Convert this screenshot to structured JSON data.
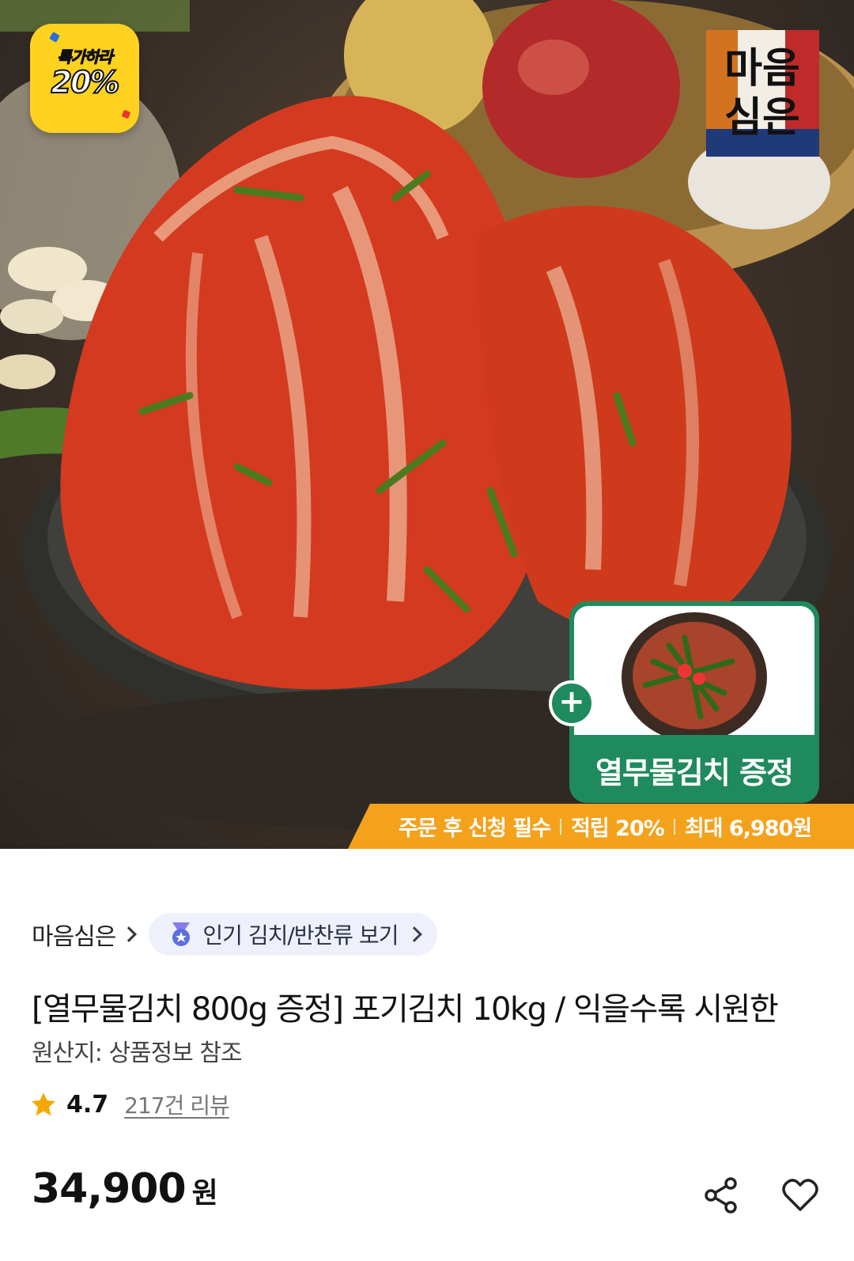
{
  "hero": {
    "deal_badge": {
      "top": "특가하라",
      "percent": "20%"
    },
    "brand_logo_text": "마음심은",
    "gift": {
      "label": "열무물김치 증정",
      "plus": "+"
    },
    "promo_strip": [
      "주문 후 신청 필수",
      "적립 20%",
      "최대 6,980원"
    ]
  },
  "store": {
    "name": "마음심은"
  },
  "category_link": {
    "label": "인기 김치/반찬류 보기"
  },
  "product": {
    "title": "[열무물김치 800g 증정] 포기김치 10kg / 익을수록 시원한",
    "origin": "원산지: 상품정보 참조",
    "rating": "4.7",
    "reviews": "217건 리뷰",
    "price": "34,900",
    "price_unit": "원"
  },
  "colors": {
    "gift_green": "#1f8a5e",
    "promo_orange": "#f4a11c",
    "badge_yellow": "#ffd21f",
    "star": "#f5a800"
  },
  "icons": [
    "medal-icon",
    "star-icon",
    "share-icon",
    "heart-icon",
    "chevron-right-icon"
  ]
}
